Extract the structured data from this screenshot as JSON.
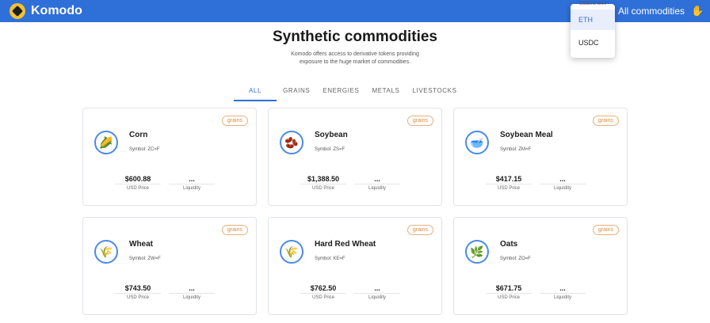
{
  "header": {
    "brand": "Komodo",
    "nav_link": "All commodities",
    "menu_icon": "hand-icon",
    "brand_color": "#2f6fd8"
  },
  "collateral_dropdown": {
    "label": "Collateral token",
    "options": [
      "ETH",
      "USDC"
    ],
    "selected": "ETH"
  },
  "main": {
    "title": "Synthetic commodities",
    "subtitle": "Komodo offers access to derivative tokens providing exposure to the huge market of commodities.",
    "tabs": [
      {
        "label": "ALL",
        "active": true
      },
      {
        "label": "GRAINS",
        "active": false
      },
      {
        "label": "ENERGIES",
        "active": false
      },
      {
        "label": "METALS",
        "active": false
      },
      {
        "label": "LIVESTOCKS",
        "active": false
      }
    ]
  },
  "cards": [
    {
      "name": "Corn",
      "symbol": "Symbol: ZC=F",
      "category": "grains",
      "price": "$600.88",
      "price_label": "USD Price",
      "liquidity": "...",
      "liquidity_label": "Liquidity",
      "icon": "corn-icon"
    },
    {
      "name": "Soybean",
      "symbol": "Symbol: ZS=F",
      "category": "grains",
      "price": "$1,388.50",
      "price_label": "USD Price",
      "liquidity": "...",
      "liquidity_label": "Liquidity",
      "icon": "soybean-icon"
    },
    {
      "name": "Soybean Meal",
      "symbol": "Symbol: ZM=F",
      "category": "grains",
      "price": "$417.15",
      "price_label": "USD Price",
      "liquidity": "...",
      "liquidity_label": "Liquidity",
      "icon": "soybean-meal-icon"
    },
    {
      "name": "Wheat",
      "symbol": "Symbol: ZW=F",
      "category": "grains",
      "price": "$743.50",
      "price_label": "USD Price",
      "liquidity": "...",
      "liquidity_label": "Liquidity",
      "icon": "wheat-icon"
    },
    {
      "name": "Hard Red Wheat",
      "symbol": "Symbol: KE=F",
      "category": "grains",
      "price": "$762.50",
      "price_label": "USD Price",
      "liquidity": "...",
      "liquidity_label": "Liquidity",
      "icon": "hard-red-wheat-icon"
    },
    {
      "name": "Oats",
      "symbol": "Symbol: ZO=F",
      "category": "grains",
      "price": "$671.75",
      "price_label": "USD Price",
      "liquidity": "...",
      "liquidity_label": "Liquidity",
      "icon": "oats-icon"
    }
  ]
}
